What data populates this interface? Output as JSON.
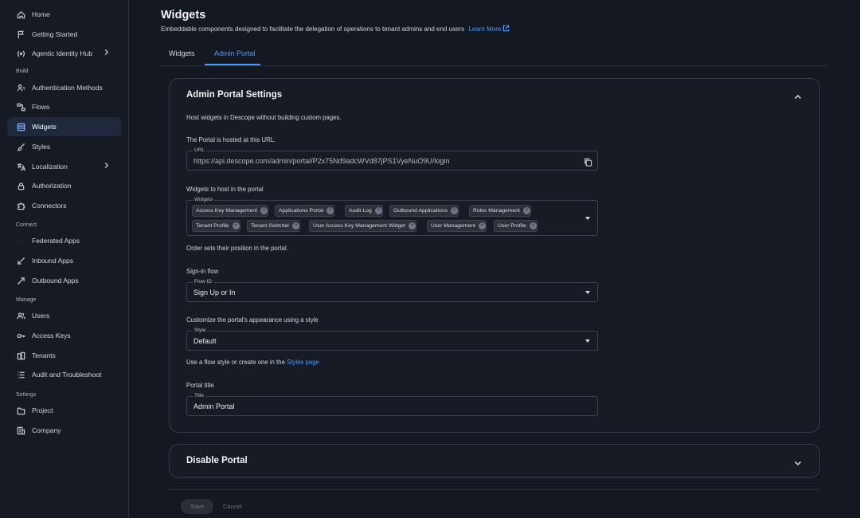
{
  "sidebar": {
    "items": [
      {
        "label": "Home",
        "icon": "home-icon"
      },
      {
        "label": "Getting Started",
        "icon": "flag-icon"
      },
      {
        "label": "Agentic Identity Hub",
        "icon": "agentic-icon"
      },
      {
        "label": "Authentication Methods",
        "icon": "auth-methods-icon"
      },
      {
        "label": "Flows",
        "icon": "flows-icon"
      },
      {
        "label": "Widgets",
        "icon": "widgets-icon"
      },
      {
        "label": "Styles",
        "icon": "brush-icon"
      },
      {
        "label": "Localization",
        "icon": "translate-icon"
      },
      {
        "label": "Authorization",
        "icon": "lock-icon"
      },
      {
        "label": "Connectors",
        "icon": "puzzle-icon"
      },
      {
        "label": "Federated Apps",
        "icon": "grid-icon"
      },
      {
        "label": "Inbound Apps",
        "icon": "arrow-in-icon"
      },
      {
        "label": "Outbound Apps",
        "icon": "arrow-out-icon"
      },
      {
        "label": "Users",
        "icon": "users-icon"
      },
      {
        "label": "Access Keys",
        "icon": "key-icon"
      },
      {
        "label": "Tenants",
        "icon": "tenants-icon"
      },
      {
        "label": "Audit and Troubleshoot",
        "icon": "list-icon"
      },
      {
        "label": "Project",
        "icon": "folder-icon"
      },
      {
        "label": "Company",
        "icon": "building-icon"
      }
    ],
    "sections": [
      "Build",
      "Connect",
      "Manage",
      "Settings"
    ]
  },
  "header": {
    "title": "Widgets",
    "subtitle": "Embeddable components designed to facilitate the delegation of operations to tenant admins and end users",
    "learn_more": "Learn More"
  },
  "tabs": [
    "Widgets",
    "Admin Portal"
  ],
  "settings": {
    "title": "Admin Portal Settings",
    "description": "Host widgets in Descope without building custom pages.",
    "hosted_label": "The Portal is hosted at this URL.",
    "url_label": "URL",
    "url_value": "https://api.descope.com/admin/portal/P2x75Nd9adcWVd87jPS1VyeNuO9U/login",
    "widgets_heading": "Widgets to host in the portal",
    "widgets_label": "Widgets",
    "widgets": [
      "Access Key Management",
      "Applications Portal",
      "Audit Log",
      "Outbound Applications",
      "Roles Management",
      "Tenant Profile",
      "Tenant Switcher",
      "User Access Key Management Widget",
      "User Management",
      "User Profile"
    ],
    "order_note": "Order sets their position in the portal.",
    "signin_heading": "Sign-in flow",
    "flow_label": "Flow ID",
    "flow_value": "Sign Up or In",
    "style_heading": "Customize the portal's appearance using a style",
    "style_label": "Style",
    "style_value": "Default",
    "style_note": "Use a flow style or create one in the",
    "style_link": "Styles page",
    "portal_title_heading": "Portal title",
    "title_label": "Title",
    "title_value": "Admin Portal"
  },
  "disable": {
    "title": "Disable Portal"
  },
  "footer": {
    "save": "Save",
    "cancel": "Cancel"
  },
  "colors": {
    "accent": "#4b9bff",
    "background": "#141820"
  }
}
